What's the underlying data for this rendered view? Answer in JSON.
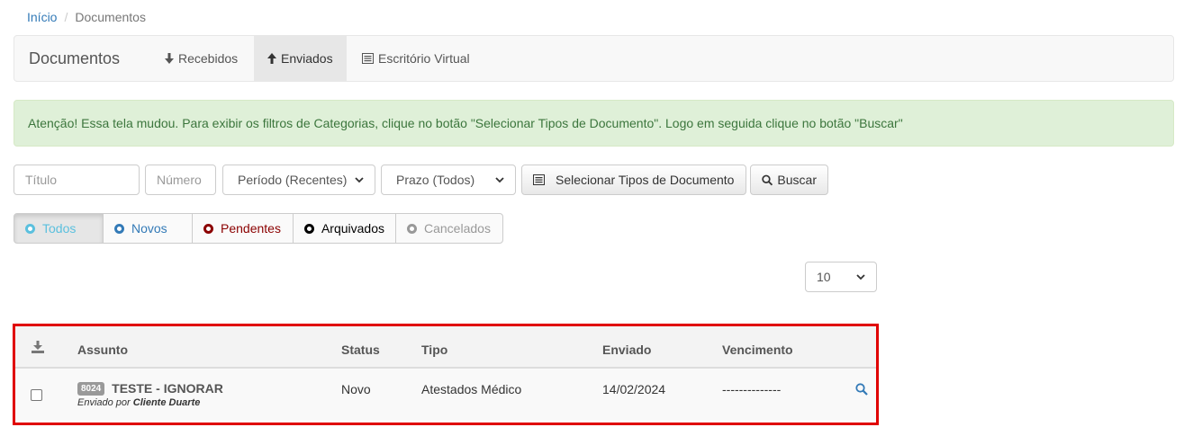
{
  "breadcrumb": {
    "home": "Início",
    "separator": "/",
    "current": "Documentos"
  },
  "navbar": {
    "brand": "Documentos",
    "tabs": [
      {
        "label": "Recebidos",
        "icon": "arrow-down-icon",
        "active": false
      },
      {
        "label": "Enviados",
        "icon": "arrow-up-icon",
        "active": true
      },
      {
        "label": "Escritório Virtual",
        "icon": "list-icon",
        "active": false
      }
    ]
  },
  "alert": {
    "text": "Atenção! Essa tela mudou. Para exibir os filtros de Categorias, clique no botão \"Selecionar Tipos de Documento\". Logo em seguida clique no botão \"Buscar\""
  },
  "filters": {
    "title_placeholder": "Título",
    "number_placeholder": "Número",
    "period": "Período (Recentes)",
    "deadline": "Prazo (Todos)",
    "select_types": "Selecionar Tipos de Documento",
    "search": "Buscar"
  },
  "status_filters": [
    {
      "label": "Todos",
      "color": "#5bc0de",
      "active": true
    },
    {
      "label": "Novos",
      "color": "#337ab7",
      "active": false
    },
    {
      "label": "Pendentes",
      "color": "#8b0000",
      "active": false
    },
    {
      "label": "Arquivados",
      "color": "#000000",
      "active": false
    },
    {
      "label": "Cancelados",
      "color": "#999999",
      "active": false
    }
  ],
  "page_size": "10",
  "table": {
    "headers": {
      "subject": "Assunto",
      "status": "Status",
      "type": "Tipo",
      "sent": "Enviado",
      "due": "Vencimento"
    },
    "rows": [
      {
        "id": "8024",
        "subject": "TESTE - IGNORAR",
        "sent_by_prefix": "Enviado por",
        "sent_by": "Cliente Duarte",
        "status": "Novo",
        "type": "Atestados Médico",
        "sent": "14/02/2024",
        "due": "--------------"
      }
    ]
  },
  "colors": {
    "link": "#337ab7",
    "alert_bg": "#dff0d8",
    "alert_text": "#3c763d",
    "highlight_border": "#e00000"
  }
}
